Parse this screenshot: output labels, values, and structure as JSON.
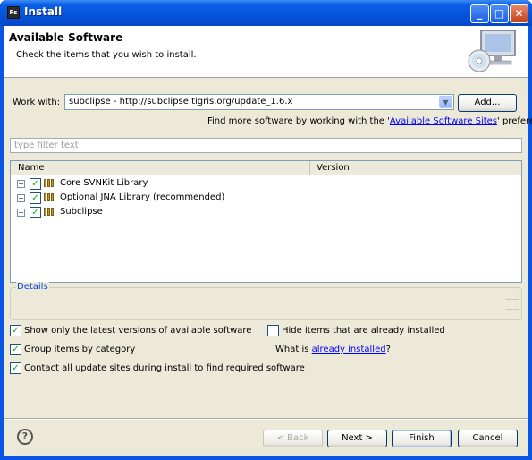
{
  "window": {
    "title": "Install",
    "icon": "eclipse-app-icon"
  },
  "banner": {
    "title": "Available Software",
    "subtitle": "Check the items that you wish to install."
  },
  "work_with": {
    "label": "Work with:",
    "value": "subclipse - http://subclipse.tigris.org/update_1.6.x",
    "add_label": "Add..."
  },
  "sites_hint": {
    "before": "Find more software by working with the '",
    "link": "Available Software Sites",
    "after": "' preferences."
  },
  "filter": {
    "placeholder": "type filter text"
  },
  "tree": {
    "columns": [
      "Name",
      "Version"
    ],
    "items": [
      {
        "label": "Core SVNKit Library",
        "checked": true
      },
      {
        "label": "Optional JNA Library (recommended)",
        "checked": true
      },
      {
        "label": "Subclipse",
        "checked": true
      }
    ]
  },
  "details": {
    "label": "Details"
  },
  "options": {
    "latest_versions": {
      "label": "Show only the latest versions of available software",
      "checked": true
    },
    "group_by_category": {
      "label": "Group items by category",
      "checked": true
    },
    "contact_update_sites": {
      "label": "Contact all update sites during install to find required software",
      "checked": true
    },
    "hide_installed": {
      "label": "Hide items that are already installed",
      "checked": false
    },
    "what_is": {
      "before": "What is ",
      "link": "already installed",
      "after": "?"
    }
  },
  "footer": {
    "back": "< Back",
    "next": "Next >",
    "finish": "Finish",
    "cancel": "Cancel"
  },
  "colors": {
    "title_bar": "#0553d8",
    "dialog_bg": "#ece9d8",
    "link": "#0000ff",
    "details_label": "#0046d5"
  }
}
